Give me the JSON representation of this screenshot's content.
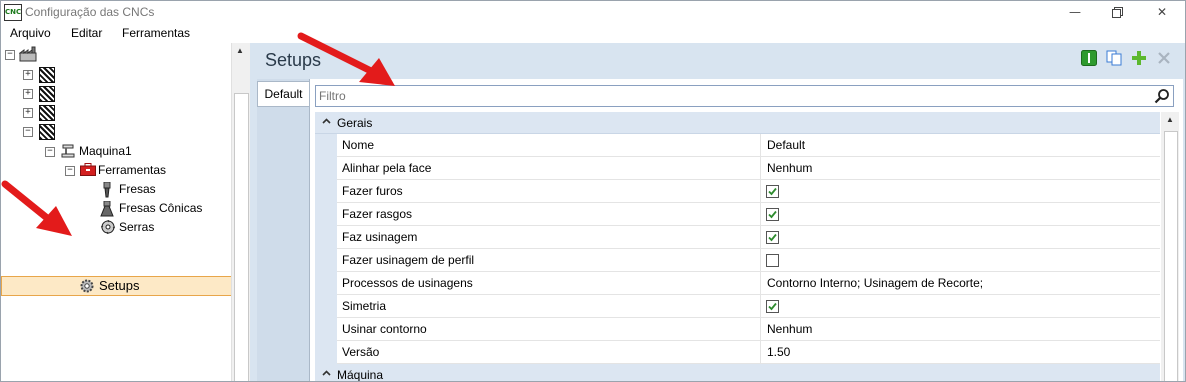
{
  "window": {
    "title": "Configuração das CNCs",
    "icon_text": "CNC",
    "controls": [
      "minimize-icon",
      "restore-icon",
      "close-icon"
    ]
  },
  "menu": [
    {
      "label": "Arquivo"
    },
    {
      "label": "Editar"
    },
    {
      "label": "Ferramentas"
    }
  ],
  "tree": {
    "machine": "Maquina1",
    "tools": "Ferramentas",
    "children": [
      "Fresas",
      "Fresas Cônicas",
      "Serras"
    ],
    "setups": "Setups"
  },
  "main": {
    "title": "Setups",
    "toolbar": [
      "info-icon",
      "copy-icon",
      "add-icon",
      "delete-icon"
    ],
    "tab": "Default",
    "filter_placeholder": "Filtro"
  },
  "grid": {
    "groups": [
      "Gerais",
      "Máquina"
    ],
    "rows": [
      {
        "name": "Nome",
        "value": "Default",
        "type": "text"
      },
      {
        "name": "Alinhar pela face",
        "value": "Nenhum",
        "type": "text"
      },
      {
        "name": "Fazer furos",
        "value": true,
        "type": "check"
      },
      {
        "name": "Fazer rasgos",
        "value": true,
        "type": "check"
      },
      {
        "name": "Faz usinagem",
        "value": true,
        "type": "check"
      },
      {
        "name": "Fazer usinagem de perfil",
        "value": false,
        "type": "check"
      },
      {
        "name": "Processos de usinagens",
        "value": "Contorno Interno; Usinagem de Recorte;",
        "type": "text"
      },
      {
        "name": "Simetria",
        "value": true,
        "type": "check"
      },
      {
        "name": "Usinar contorno",
        "value": "Nenhum",
        "type": "text"
      },
      {
        "name": "Versão",
        "value": "1.50",
        "type": "text"
      }
    ]
  },
  "colors": {
    "accent_red_arrow": "#e31b1b",
    "selection_bg": "#fde9c6",
    "selection_border": "#e8a64a",
    "panel_bg": "#d8e4f0",
    "group_bg": "#dce6f2",
    "check_green": "#2e8b2e"
  }
}
